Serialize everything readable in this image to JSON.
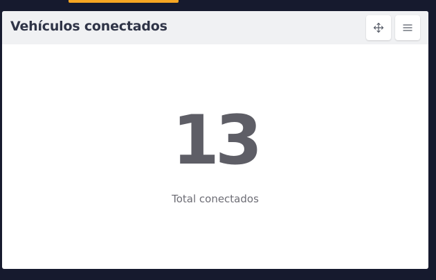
{
  "topbar": {
    "active_indicator_color": "#f6a623"
  },
  "widget": {
    "title": "Vehículos conectados",
    "move_icon": "move-arrows-icon",
    "menu_icon": "hamburger-menu-icon",
    "value": "13",
    "label": "Total conectados"
  }
}
